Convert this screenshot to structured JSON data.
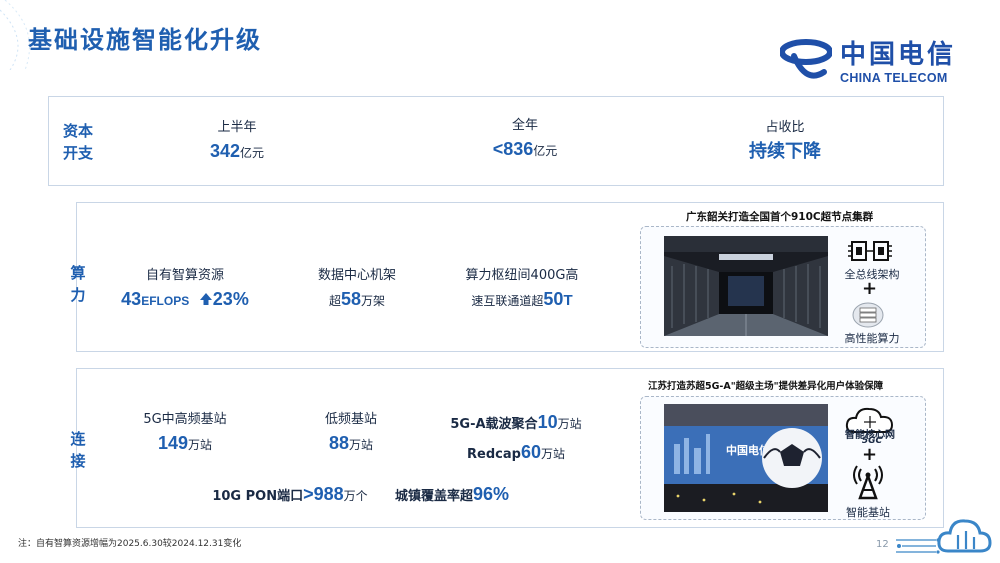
{
  "title": "基础设施智能化升级",
  "logo": {
    "cn": "中国电信",
    "en": "CHINA TELECOM"
  },
  "capex": {
    "row_label": [
      "资本",
      "开支"
    ],
    "items": [
      {
        "label": "上半年",
        "value": "342",
        "unit": "亿元"
      },
      {
        "label": "全年",
        "value": "<836",
        "unit": "亿元"
      },
      {
        "label": "占收比",
        "value": "持续下降"
      }
    ]
  },
  "compute": {
    "row_label": [
      "算",
      "力"
    ],
    "items": [
      {
        "label": "自有智算资源",
        "value": "43",
        "value_unit": "EFLOPS",
        "growth": "23%"
      },
      {
        "label": "数据中心机架",
        "prefix": "超",
        "value": "58",
        "unit": "万架"
      },
      {
        "label": "算力枢纽间400G高",
        "prefix": "速互联通道超",
        "value": "50",
        "unit": "T"
      }
    ],
    "panel": {
      "title": "广东韶关打造全国首个910C超节点集群",
      "feature1": "全总线架构",
      "feature2": "高性能算力",
      "plus": "+"
    }
  },
  "connectivity": {
    "row_label": [
      "连",
      "接"
    ],
    "items": [
      {
        "label": "5G中高频基站",
        "value": "149",
        "unit": "万站"
      },
      {
        "label": "低频基站",
        "value": "88",
        "unit": "万站"
      },
      {
        "label": "5G-A载波聚合",
        "value": "10",
        "unit": "万站"
      },
      {
        "label": "Redcap",
        "value": "60",
        "unit": "万站"
      },
      {
        "label": "10G PON端口",
        "value": ">988",
        "unit": "万个"
      },
      {
        "label": "城镇覆盖率超",
        "value": "96%"
      }
    ],
    "panel": {
      "title": "江苏打造苏超5G-A\"超级主场\"提供差异化用户体验保障",
      "core_label": "智能核心网",
      "core_sub": "5GC",
      "station_label": "智能基站",
      "plus": "+"
    }
  },
  "footnote": "注：自有智算资源增幅为2025.6.30较2024.12.31变化",
  "page_number": "12",
  "colors": {
    "accent": "#1f5fb0",
    "border": "#c9d6e6"
  }
}
